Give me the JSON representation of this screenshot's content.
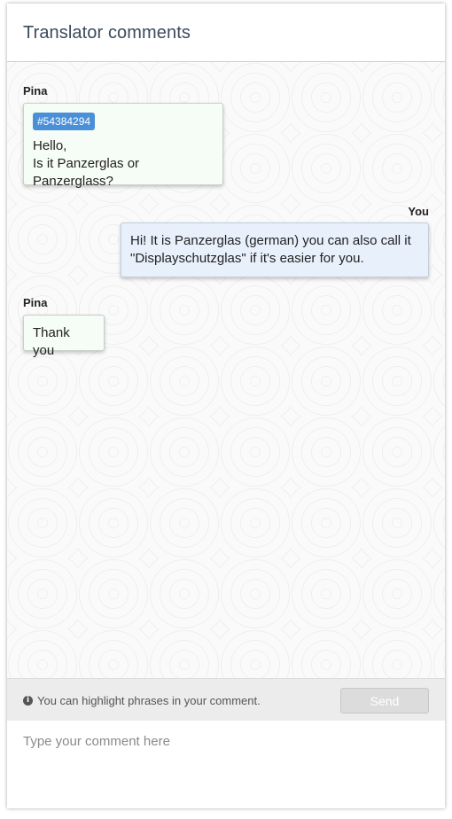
{
  "header": {
    "title": "Translator comments"
  },
  "messages": [
    {
      "sender": "Pina",
      "tag": "#54384294",
      "line1": "Hello,",
      "line2": "Is it Panzerglas or Panzerglass?"
    },
    {
      "sender": "You",
      "line1": "Hi! It is Panzerglas (german) you can also call it",
      "line2": "\"Displayschutzglas\" if it's easier for you."
    },
    {
      "sender": "Pina",
      "text": "Thank you"
    }
  ],
  "footer": {
    "hint": "You can highlight phrases in your comment.",
    "send_label": "Send",
    "input_placeholder": "Type your comment here",
    "input_value": ""
  },
  "colors": {
    "tag": "#4a90d9",
    "incoming_bubble": "#f6fcf6",
    "outgoing_bubble": "#e8f0fb",
    "header_title": "#3c4a5c"
  }
}
